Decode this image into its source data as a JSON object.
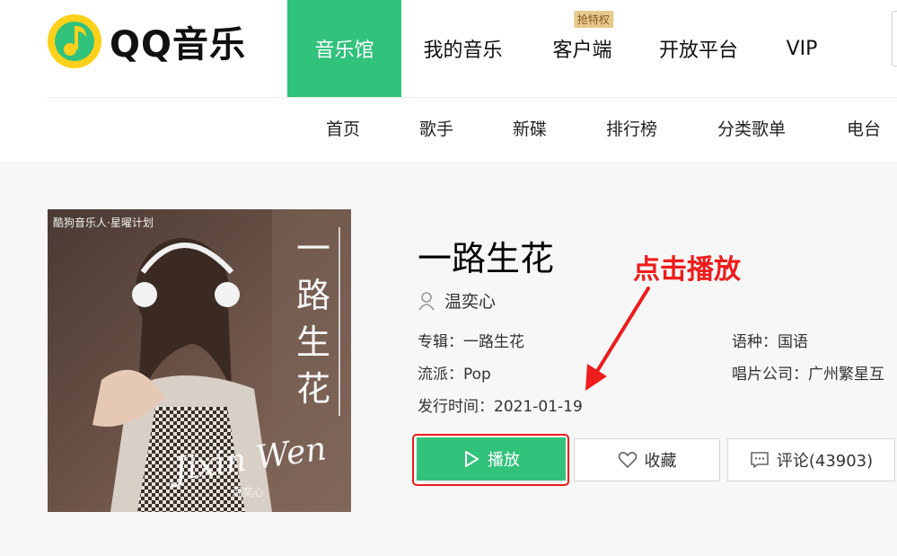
{
  "brand": {
    "name": "QQ音乐",
    "color": "#31c27c"
  },
  "nav": {
    "items": [
      {
        "label": "音乐馆"
      },
      {
        "label": "我的音乐"
      },
      {
        "label": "客户端",
        "badge": "抢特权"
      },
      {
        "label": "开放平台"
      },
      {
        "label": "VIP"
      }
    ]
  },
  "subnav": {
    "items": [
      "首页",
      "歌手",
      "新碟",
      "排行榜",
      "分类歌单",
      "电台"
    ]
  },
  "album": {
    "cover": {
      "top_text": "酷狗音乐人·星曜计划",
      "vertical_title": "一路生花",
      "signature": "Jixin Wen",
      "small_name": "温奕心"
    },
    "title": "一路生花",
    "singer": "温奕心",
    "album_label": "专辑：一路生花",
    "language_label": "语种：国语",
    "genre_label": "流派：Pop",
    "company_label": "唱片公司：广州繁星互",
    "release_label": "发行时间：2021-01-19"
  },
  "actions": {
    "play": "播放",
    "collect": "收藏",
    "comment": "评论(43903)"
  },
  "annotation": {
    "text": "点击播放",
    "color": "#ee1c1c"
  },
  "icons": [
    "qq-music-logo-icon",
    "user-icon",
    "play-icon",
    "heart-icon",
    "comment-icon"
  ]
}
